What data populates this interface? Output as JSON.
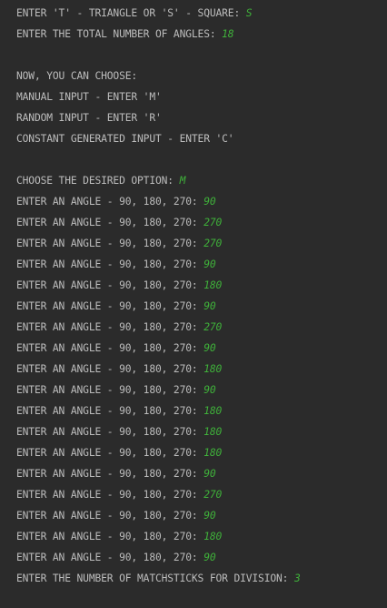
{
  "colors": {
    "background": "#2b2b2b",
    "output_text": "#bcbcbc",
    "user_input": "#3fb13a"
  },
  "console": {
    "lines": [
      {
        "text": "ENTER 'T' - TRIANGLE OR 'S' - SQUARE: ",
        "input": "S"
      },
      {
        "text": "ENTER THE TOTAL NUMBER OF ANGLES: ",
        "input": "18"
      },
      {
        "text": "",
        "input": ""
      },
      {
        "text": "NOW, YOU CAN CHOOSE:",
        "input": ""
      },
      {
        "text": "MANUAL INPUT - ENTER 'M'",
        "input": ""
      },
      {
        "text": "RANDOM INPUT - ENTER 'R'",
        "input": ""
      },
      {
        "text": "CONSTANT GENERATED INPUT - ENTER 'C'",
        "input": ""
      },
      {
        "text": "",
        "input": ""
      },
      {
        "text": "CHOOSE THE DESIRED OPTION: ",
        "input": "M"
      },
      {
        "text": "ENTER AN ANGLE - 90, 180, 270: ",
        "input": "90"
      },
      {
        "text": "ENTER AN ANGLE - 90, 180, 270: ",
        "input": "270"
      },
      {
        "text": "ENTER AN ANGLE - 90, 180, 270: ",
        "input": "270"
      },
      {
        "text": "ENTER AN ANGLE - 90, 180, 270: ",
        "input": "90"
      },
      {
        "text": "ENTER AN ANGLE - 90, 180, 270: ",
        "input": "180"
      },
      {
        "text": "ENTER AN ANGLE - 90, 180, 270: ",
        "input": "90"
      },
      {
        "text": "ENTER AN ANGLE - 90, 180, 270: ",
        "input": "270"
      },
      {
        "text": "ENTER AN ANGLE - 90, 180, 270: ",
        "input": "90"
      },
      {
        "text": "ENTER AN ANGLE - 90, 180, 270: ",
        "input": "180"
      },
      {
        "text": "ENTER AN ANGLE - 90, 180, 270: ",
        "input": "90"
      },
      {
        "text": "ENTER AN ANGLE - 90, 180, 270: ",
        "input": "180"
      },
      {
        "text": "ENTER AN ANGLE - 90, 180, 270: ",
        "input": "180"
      },
      {
        "text": "ENTER AN ANGLE - 90, 180, 270: ",
        "input": "180"
      },
      {
        "text": "ENTER AN ANGLE - 90, 180, 270: ",
        "input": "90"
      },
      {
        "text": "ENTER AN ANGLE - 90, 180, 270: ",
        "input": "270"
      },
      {
        "text": "ENTER AN ANGLE - 90, 180, 270: ",
        "input": "90"
      },
      {
        "text": "ENTER AN ANGLE - 90, 180, 270: ",
        "input": "180"
      },
      {
        "text": "ENTER AN ANGLE - 90, 180, 270: ",
        "input": "90"
      },
      {
        "text": "ENTER THE NUMBER OF MATCHSTICKS FOR DIVISION: ",
        "input": "3"
      }
    ]
  }
}
